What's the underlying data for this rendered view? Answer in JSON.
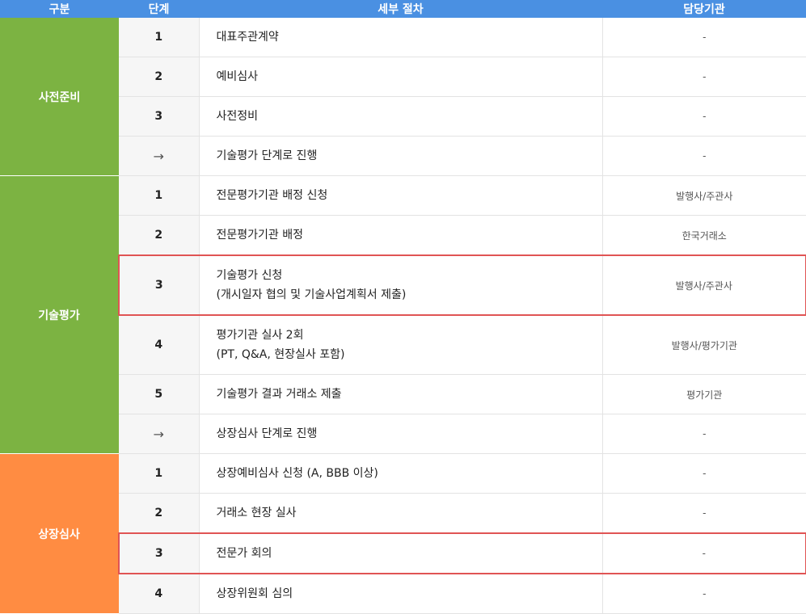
{
  "header": {
    "category": "구분",
    "step": "단계",
    "detail": "세부 절차",
    "org": "담당기관"
  },
  "colors": {
    "header_bg": "#4a90e2",
    "stage1": "#7cb342",
    "stage2": "#7cb342",
    "stage3": "#ff8c42",
    "highlight_border": "#e05454"
  },
  "stages": [
    {
      "name": "사전준비",
      "rows": [
        {
          "step": "1",
          "detail": [
            "대표주관계약"
          ],
          "org": "-"
        },
        {
          "step": "2",
          "detail": [
            "예비심사"
          ],
          "org": "-"
        },
        {
          "step": "3",
          "detail": [
            "사전정비"
          ],
          "org": "-"
        },
        {
          "step": "→",
          "detail": [
            "기술평가 단계로 진행"
          ],
          "org": "-"
        }
      ]
    },
    {
      "name": "기술평가",
      "rows": [
        {
          "step": "1",
          "detail": [
            "전문평가기관 배정 신청"
          ],
          "org": "발행사/주관사"
        },
        {
          "step": "2",
          "detail": [
            "전문평가기관 배정"
          ],
          "org": "한국거래소"
        },
        {
          "step": "3",
          "detail": [
            "기술평가 신청",
            "(개시일자 협의 및 기술사업계획서 제출)"
          ],
          "org": "발행사/주관사",
          "highlighted": true
        },
        {
          "step": "4",
          "detail": [
            "평가기관 실사 2회",
            "(PT, Q&A, 현장실사 포함)"
          ],
          "org": "발행사/평가기관"
        },
        {
          "step": "5",
          "detail": [
            "기술평가 결과 거래소 제출"
          ],
          "org": "평가기관"
        },
        {
          "step": "→",
          "detail": [
            "상장심사 단계로 진행"
          ],
          "org": "-"
        }
      ]
    },
    {
      "name": "상장심사",
      "rows": [
        {
          "step": "1",
          "detail": [
            "상장예비심사 신청 (A, BBB 이상)"
          ],
          "org": "-"
        },
        {
          "step": "2",
          "detail": [
            "거래소 현장 실사"
          ],
          "org": "-"
        },
        {
          "step": "3",
          "detail": [
            "전문가 회의"
          ],
          "org": "-",
          "highlighted": true
        },
        {
          "step": "4",
          "detail": [
            "상장위원회 심의"
          ],
          "org": "-"
        }
      ]
    }
  ]
}
